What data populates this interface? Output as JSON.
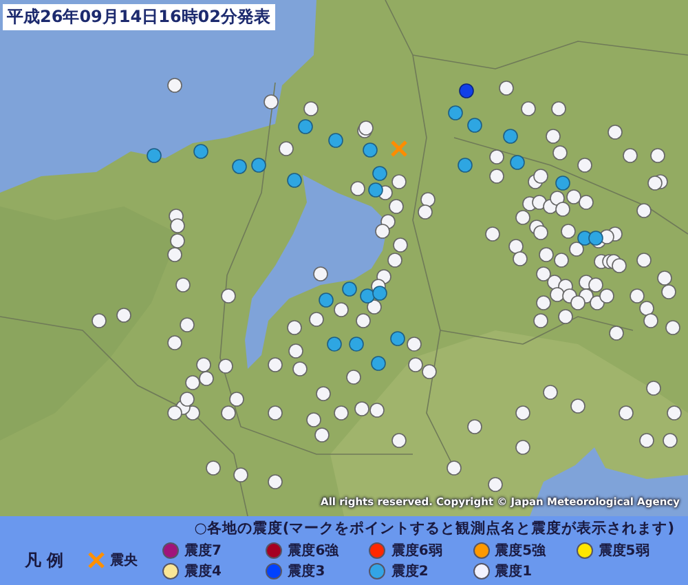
{
  "title": "平成26年09月14日16時02分発表",
  "copyright": "All rights reserved. Copyright © Japan Meteorological Agency",
  "legend": {
    "heading": "凡 例",
    "caption": "○各地の震度(マークをポイントすると観測点名と震度が表示されます)",
    "items": [
      {
        "kind": "cross",
        "label": "震央"
      },
      {
        "kind": "dot",
        "label": "震度7",
        "color": "#a0147a"
      },
      {
        "kind": "dot",
        "label": "震度6強",
        "color": "#a50021"
      },
      {
        "kind": "dot",
        "label": "震度6弱",
        "color": "#ff2800"
      },
      {
        "kind": "dot",
        "label": "震度5強",
        "color": "#ff9900"
      },
      {
        "kind": "dot",
        "label": "震度5弱",
        "color": "#ffe600"
      },
      {
        "kind": "dot",
        "label": "震度4",
        "color": "#fae696"
      },
      {
        "kind": "dot",
        "label": "震度3",
        "color": "#0041ff"
      },
      {
        "kind": "dot",
        "label": "震度2",
        "color": "#33a5e6"
      },
      {
        "kind": "dot",
        "label": "震度1",
        "color": "#f2f2ff"
      }
    ]
  }
}
